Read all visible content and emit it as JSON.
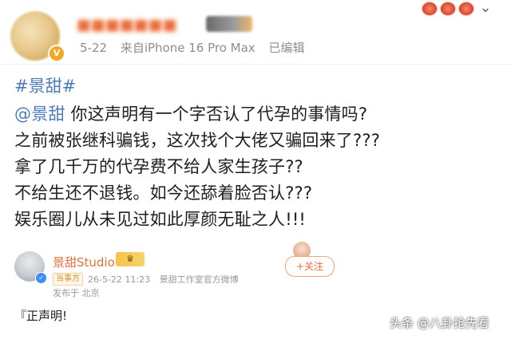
{
  "post": {
    "meta": {
      "date": "5-22",
      "source": "来自iPhone 16 Pro Max",
      "edited": "已编辑"
    },
    "hashtag": "#景甜#",
    "mention": "@景甜",
    "lines": [
      " 你这声明有一个字否认了代孕的事情吗?",
      "之前被张继科骗钱，这次找个大佬又骗回来了???",
      "拿了几千万的代孕费不给人家生孩子??",
      "不给生还不退钱。如今还舔着脸否认???",
      "娱乐圈儿从未见过如此厚颜无耻之人!!!"
    ]
  },
  "card": {
    "name": "景甜Studio",
    "party_tag": "当事方",
    "time": "26-5-22 11:23",
    "source": "景甜工作室官方微博",
    "location": "发布于 北京",
    "follow_label": "+关注"
  },
  "statement": "『正声明!",
  "watermark": "头条 @八卦抢先看",
  "icons": {
    "more": "more-icon",
    "verify": "verified-icon",
    "crown": "crown-icon"
  },
  "colors": {
    "link": "#4d7cb8",
    "name_orange": "#e4713c",
    "meta_gray": "#8e8e8e"
  }
}
